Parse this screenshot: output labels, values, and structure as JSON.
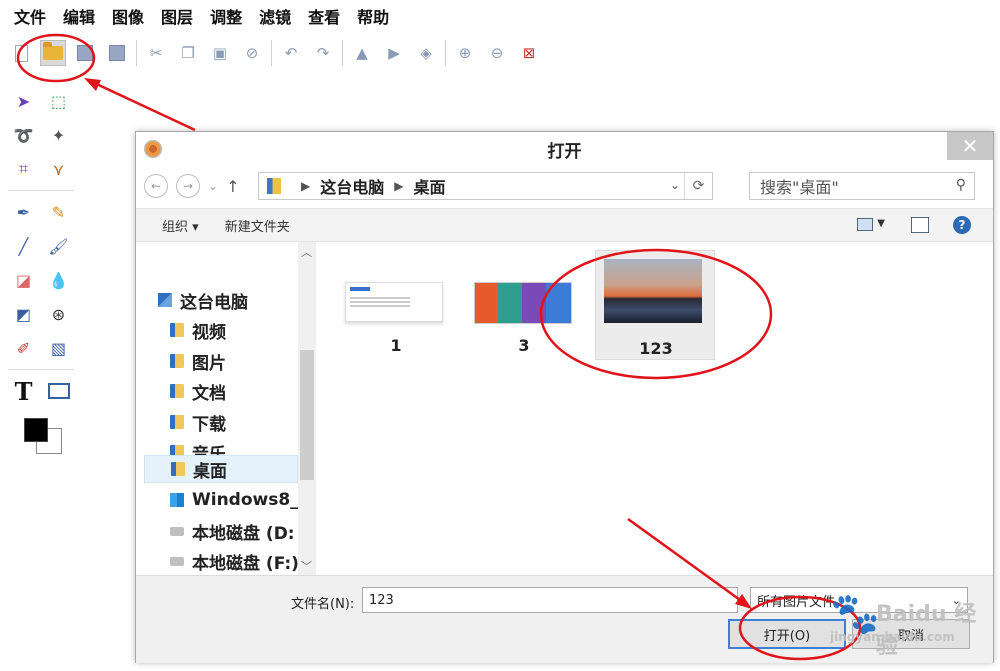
{
  "menu": [
    "文件",
    "编辑",
    "图像",
    "图层",
    "调整",
    "滤镜",
    "查看",
    "帮助"
  ],
  "tools": {
    "text_glyph": "T"
  },
  "dialog": {
    "title": "打开",
    "breadcrumb": [
      "这台电脑",
      "桌面"
    ],
    "search_placeholder": "搜索\"桌面\"",
    "commands": [
      "组织",
      "新建文件夹"
    ],
    "nav": [
      "这台电脑",
      "视频",
      "图片",
      "文档",
      "下载",
      "音乐",
      "桌面",
      "Windows8_",
      "本地磁盘 (D:",
      "本地磁盘 (F:)"
    ],
    "files": [
      "1",
      "3",
      "123"
    ],
    "filename_label": "文件名(N):",
    "filename_value": "123",
    "filetype": "所有图片文件",
    "open_button": "打开(O)",
    "cancel_button": "取消"
  },
  "watermark": {
    "brand": "Baidu 经验",
    "domain": "jingyan.baidu.com"
  },
  "colors": {
    "accent": "#3c7fd5",
    "annotation": "#e0141a",
    "selection": "#e5f1fb"
  }
}
